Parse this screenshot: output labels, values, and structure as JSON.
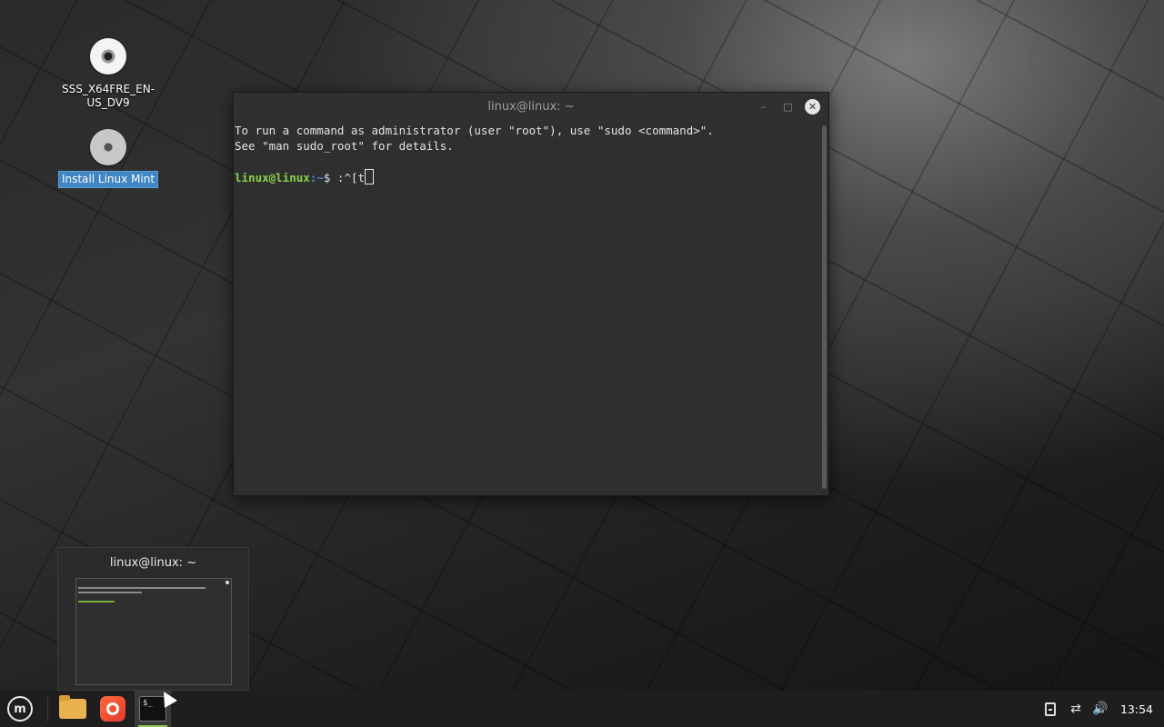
{
  "desktop": {
    "icons": [
      {
        "label": "SSS_X64FRE_EN-US_DV9",
        "icon": "disc-icon"
      },
      {
        "label": "Install Linux Mint",
        "icon": "disc-icon",
        "selected": true
      }
    ]
  },
  "terminal": {
    "title": "linux@linux: ~",
    "lines": [
      "To run a command as administrator (user \"root\"), use \"sudo <command>\".",
      "See \"man sudo_root\" for details."
    ],
    "prompt_user": "linux@linux",
    "prompt_path": ":~",
    "prompt_symbol": "$ ",
    "current_input": ":^[t",
    "buttons": {
      "minimize": "–",
      "maximize": "□",
      "close": "✕"
    }
  },
  "taskbar_preview": {
    "title": "linux@linux: ~"
  },
  "panel": {
    "menu_icon": "linux-mint-logo",
    "launchers": [
      "files-icon",
      "firefox-icon",
      "terminal-icon"
    ],
    "terminal_icon_text": "$_",
    "tray": [
      "notes-icon",
      "network-icon",
      "volume-icon"
    ],
    "clock": "13:54"
  },
  "colors": {
    "prompt_user": "#8ad24a",
    "prompt_path": "#4f8fd6",
    "selection": "#3f86c2",
    "folder": "#e9b24e",
    "firefox": "#ff6a3d"
  }
}
